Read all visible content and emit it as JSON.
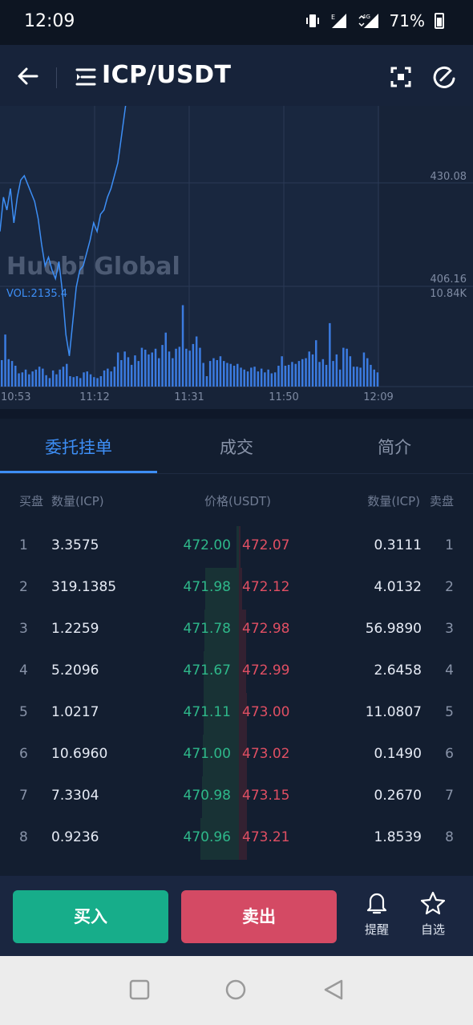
{
  "status_bar": {
    "time": "12:09",
    "battery": "71%",
    "network": "4G",
    "signal_label": "E"
  },
  "header": {
    "pair": "ICP/USDT"
  },
  "chart_data": {
    "type": "line",
    "watermark": "Huobi Global",
    "price_labels": [
      "430.08",
      "406.16"
    ],
    "volume_label": "VOL:2135.4",
    "volume_max_label": "10.84K",
    "x_ticks": [
      "10:53",
      "11:12",
      "11:31",
      "11:50",
      "12:09"
    ],
    "price_series": [
      418,
      426,
      423,
      428,
      420,
      426,
      430,
      431,
      429,
      427,
      425,
      421,
      415,
      410,
      412,
      409,
      407,
      411,
      404,
      394,
      389,
      397,
      405,
      409,
      410,
      413,
      416,
      420,
      418,
      422,
      423,
      426,
      428,
      431,
      434,
      440,
      446,
      452
    ],
    "volume_series": [
      0.28,
      0.55,
      0.29,
      0.27,
      0.22,
      0.14,
      0.15,
      0.18,
      0.13,
      0.16,
      0.18,
      0.21,
      0.19,
      0.12,
      0.09,
      0.17,
      0.13,
      0.18,
      0.21,
      0.24,
      0.11,
      0.1,
      0.11,
      0.09,
      0.15,
      0.16,
      0.13,
      0.1,
      0.09,
      0.11,
      0.17,
      0.19,
      0.16,
      0.21,
      0.36,
      0.28,
      0.37,
      0.31,
      0.23,
      0.33,
      0.27,
      0.41,
      0.39,
      0.34,
      0.36,
      0.4,
      0.3,
      0.44,
      0.57,
      0.37,
      0.3,
      0.4,
      0.42,
      0.86,
      0.4,
      0.38,
      0.45,
      0.53,
      0.41,
      0.25,
      0.11,
      0.27,
      0.3,
      0.28,
      0.32,
      0.27,
      0.25,
      0.24,
      0.22,
      0.24,
      0.2,
      0.18,
      0.16,
      0.2,
      0.21,
      0.16,
      0.19,
      0.15,
      0.18,
      0.14,
      0.15,
      0.22,
      0.32,
      0.22,
      0.23,
      0.26,
      0.24,
      0.27,
      0.29,
      0.3,
      0.37,
      0.34,
      0.49,
      0.26,
      0.29,
      0.23,
      0.67,
      0.27,
      0.34,
      0.18,
      0.41,
      0.4,
      0.32,
      0.21,
      0.21,
      0.2,
      0.36,
      0.3,
      0.23,
      0.18,
      0.15
    ]
  },
  "tabs": [
    {
      "label": "委托挂单",
      "active": true
    },
    {
      "label": "成交",
      "active": false
    },
    {
      "label": "简介",
      "active": false
    }
  ],
  "order_book": {
    "headers": {
      "buy": "买盘",
      "buy_qty": "数量(ICP)",
      "price": "价格(USDT)",
      "sell_qty": "数量(ICP)",
      "sell": "卖盘"
    },
    "rows": [
      {
        "idx": "1",
        "bid_qty": "3.3575",
        "bid": "472.00",
        "ask": "472.07",
        "ask_qty": "0.3111",
        "bid_depth": 0.05,
        "ask_depth": 0.05
      },
      {
        "idx": "2",
        "bid_qty": "319.1385",
        "bid": "471.98",
        "ask": "472.12",
        "ask_qty": "4.0132",
        "bid_depth": 0.75,
        "ask_depth": 0.12
      },
      {
        "idx": "3",
        "bid_qty": "1.2259",
        "bid": "471.78",
        "ask": "472.98",
        "ask_qty": "56.9890",
        "bid_depth": 0.76,
        "ask_depth": 0.25
      },
      {
        "idx": "4",
        "bid_qty": "5.2096",
        "bid": "471.67",
        "ask": "472.99",
        "ask_qty": "2.6458",
        "bid_depth": 0.78,
        "ask_depth": 0.26
      },
      {
        "idx": "5",
        "bid_qty": "1.0217",
        "bid": "471.11",
        "ask": "473.00",
        "ask_qty": "11.0807",
        "bid_depth": 0.79,
        "ask_depth": 0.28
      },
      {
        "idx": "6",
        "bid_qty": "10.6960",
        "bid": "471.00",
        "ask": "473.02",
        "ask_qty": "0.1490",
        "bid_depth": 0.81,
        "ask_depth": 0.28
      },
      {
        "idx": "7",
        "bid_qty": "7.3304",
        "bid": "470.98",
        "ask": "473.15",
        "ask_qty": "0.2670",
        "bid_depth": 0.83,
        "ask_depth": 0.28
      },
      {
        "idx": "8",
        "bid_qty": "0.9236",
        "bid": "470.96",
        "ask": "473.21",
        "ask_qty": "1.8539",
        "bid_depth": 0.85,
        "ask_depth": 0.28
      }
    ]
  },
  "actions": {
    "buy_label": "买入",
    "sell_label": "卖出",
    "alert_label": "提醒",
    "favorite_label": "自选"
  },
  "colors": {
    "bid": "#2eb88a",
    "ask": "#e04f63",
    "accent": "#3d8ef5",
    "buy_button": "#17ad8a",
    "sell_button": "#d44a64"
  },
  "icons": [
    "back-arrow-icon",
    "menu-list-icon",
    "scan-icon",
    "theme-toggle-icon",
    "bell-icon",
    "star-icon",
    "nav-square-icon",
    "nav-circle-icon",
    "nav-triangle-icon"
  ]
}
